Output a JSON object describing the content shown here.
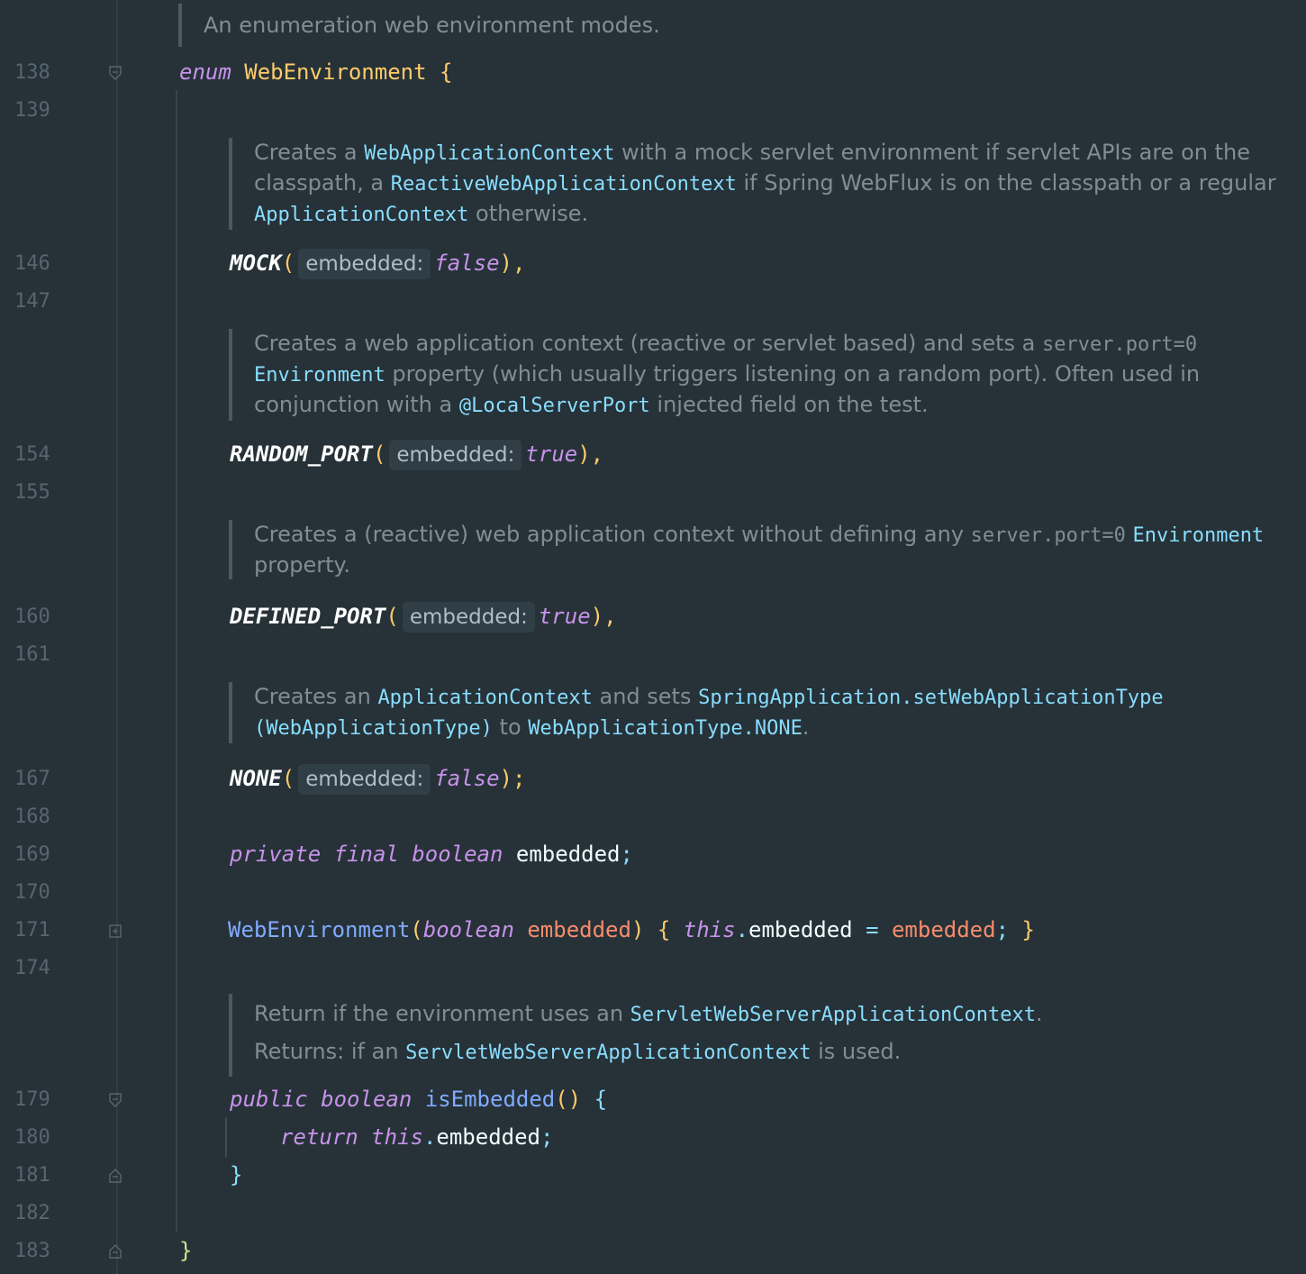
{
  "editor": {
    "line_numbers": [
      "138",
      "139",
      "146",
      "147",
      "154",
      "155",
      "160",
      "161",
      "167",
      "168",
      "169",
      "170",
      "171",
      "174",
      "179",
      "180",
      "181",
      "182",
      "183"
    ],
    "header_doc": "An enumeration web environment modes.",
    "enum_keyword": "enum",
    "enum_name": "WebEnvironment",
    "open_brace": "{",
    "doc_mock": {
      "p1": "Creates a ",
      "m1": "WebApplicationContext",
      "p2": " with a mock servlet environment if servlet APIs are on the",
      "p3": "classpath, a ",
      "m2": "ReactiveWebApplicationContext",
      "p4": " if Spring WebFlux is on the classpath or a regular",
      "m3": "ApplicationContext",
      "p5": " otherwise."
    },
    "doc_random": {
      "p1": "Creates a web application context (reactive or servlet based) and sets a ",
      "c1": "server.port=0",
      "m1": "Environment",
      "p2": " property (which usually triggers listening on a random port). Often used in",
      "p3": "conjunction with a ",
      "m2": "@LocalServerPort",
      "p4": " injected field on the test."
    },
    "doc_defined": {
      "p1": "Creates a (reactive) web application context without defining any ",
      "c1": "server.port=0",
      "m1": "Environment",
      "p2": "property."
    },
    "doc_none": {
      "p1": "Creates an ",
      "m1": "ApplicationContext",
      "p2": " and sets ",
      "m2": "SpringApplication.setWebApplicationType",
      "m3": "(WebApplicationType)",
      "p3": " to ",
      "m4": "WebApplicationType.NONE",
      "p4": "."
    },
    "doc_embedded": {
      "p1": "Return if the environment uses an ",
      "m1": "ServletWebServerApplicationContext",
      "p2": ".",
      "p3": "Returns: if an ",
      "m2": "ServletWebServerApplicationContext",
      "p4": " is used."
    },
    "constants": [
      {
        "name": "MOCK",
        "hint": "embedded:",
        "value": "false",
        "end": "),"
      },
      {
        "name": "RANDOM_PORT",
        "hint": "embedded:",
        "value": "true",
        "end": "),"
      },
      {
        "name": "DEFINED_PORT",
        "hint": "embedded:",
        "value": "true",
        "end": "),"
      },
      {
        "name": "NONE",
        "hint": "embedded:",
        "value": "false",
        "end": ");"
      }
    ],
    "field": {
      "mods": "private final boolean",
      "name": "embedded",
      "end": ";"
    },
    "ctor": {
      "name": "WebEnvironment",
      "ptype": "boolean",
      "pname": "embedded",
      "this_kw": "this",
      "field": "embedded",
      "eq": "=",
      "rhs": "embedded",
      "semi": ";"
    },
    "method": {
      "mods": "public boolean",
      "name": "isEmbedded",
      "parens": "()",
      "return_kw": "return",
      "this_kw": "this",
      "field": "embedded",
      "semi": ";",
      "close": "}"
    },
    "class_close": "}"
  },
  "colors": {
    "background": "#263238",
    "keyword": "#c792ea",
    "class": "#ffcb6b",
    "method": "#82aaff",
    "param": "#f78c6c",
    "doc_text": "#7f8e95",
    "doc_link": "#89ddff"
  }
}
